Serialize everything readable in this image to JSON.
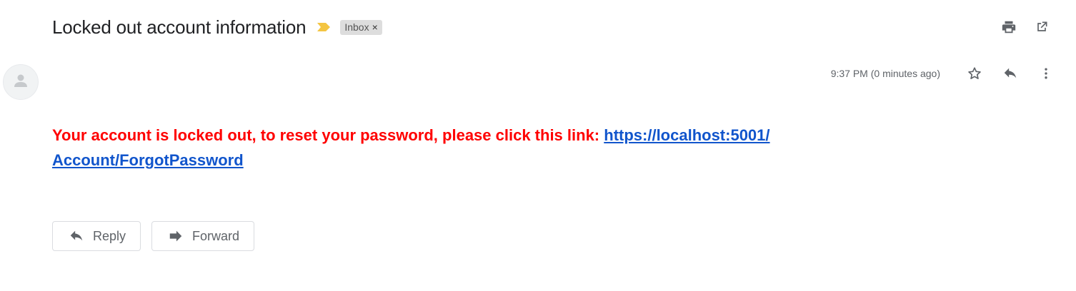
{
  "email": {
    "subject": "Locked out account information",
    "label": "Inbox",
    "label_close": "×",
    "timestamp": "9:37 PM (0 minutes ago)",
    "body_text": "Your account is locked out, to reset your password, please click this link: ",
    "link_line1": "https://localhost:5001/",
    "link_line2": "Account/ForgotPassword"
  },
  "actions": {
    "reply_label": "Reply",
    "forward_label": "Forward"
  },
  "icons": {
    "importance": "importance-marker-icon",
    "print": "print-icon",
    "open_new_window": "open-in-new-window-icon",
    "star": "star-icon",
    "reply": "reply-icon",
    "more": "more-vertical-icon",
    "avatar": "avatar-placeholder-icon",
    "forward": "forward-icon"
  },
  "colors": {
    "body_text": "#ff0000",
    "link": "#1155cc",
    "importance": "#f4c542",
    "chip_background": "#dddddd"
  }
}
